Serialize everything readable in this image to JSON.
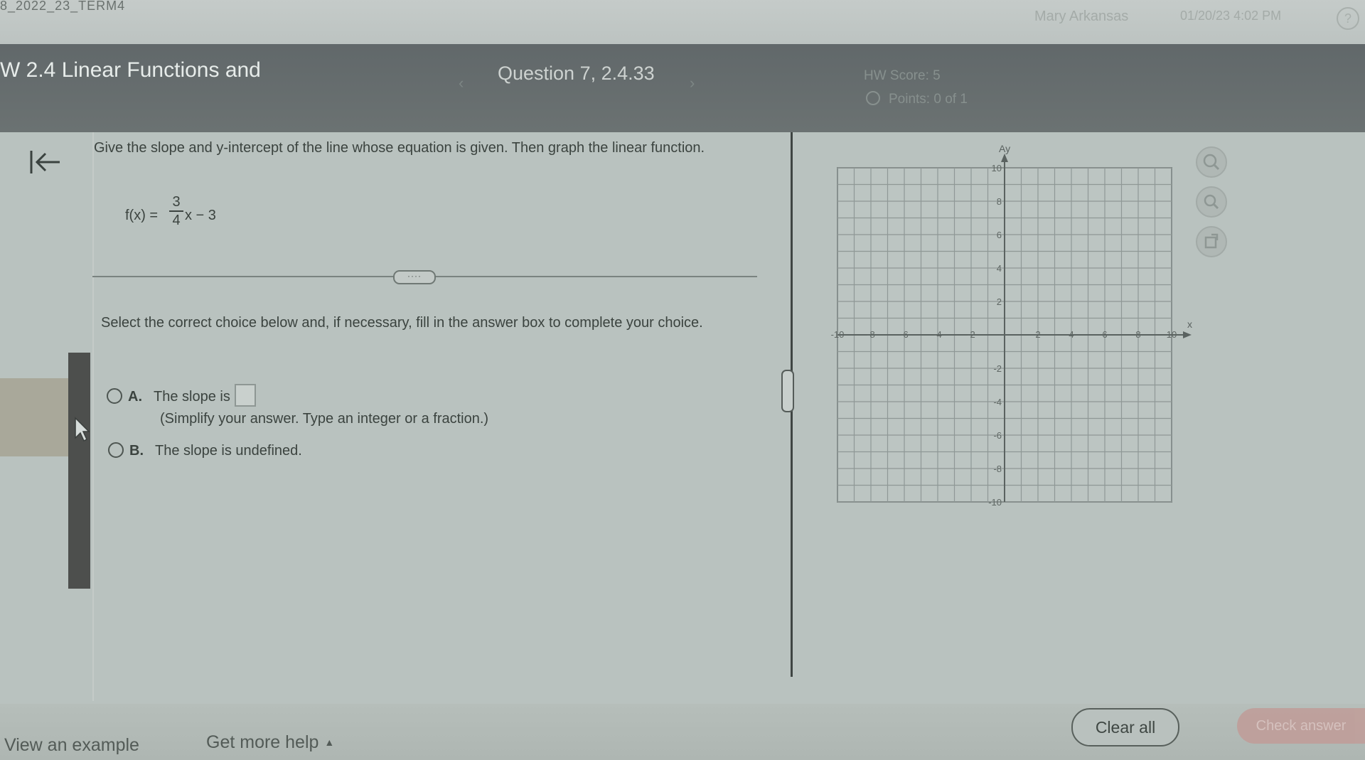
{
  "top": {
    "course": "8_2022_23_TERM4",
    "user": "Mary Arkansas",
    "datetime": "01/20/23 4:02 PM",
    "help_icon": "question-circle-icon"
  },
  "header": {
    "assignment_title": "W 2.4 Linear Functions and",
    "question_title": "Question 7, 2.4.33",
    "hw_score": "HW Score: 5",
    "points": "Points: 0 of 1"
  },
  "question": {
    "instructions": "Give the slope and y-intercept of the line whose equation is given. Then graph the linear function.",
    "equation": {
      "lhs": "f(x) =",
      "numerator": "3",
      "denominator": "4",
      "rhs": "x − 3"
    },
    "select_text": "Select the correct choice below and, if necessary, fill in the answer box to complete your choice.",
    "choice_a": {
      "letter": "A.",
      "text": "The slope is",
      "hint": "(Simplify your answer. Type an integer or a fraction.)"
    },
    "choice_b": {
      "letter": "B.",
      "text": "The slope is undefined."
    }
  },
  "graph": {
    "y_label": "Ay",
    "x_label": "x",
    "x_min": -10,
    "x_max": 10,
    "y_min": -10,
    "y_max": 10,
    "step": 1,
    "x_tick_labels": [
      "-10",
      "-8",
      "-6",
      "-4",
      "-2",
      "2",
      "4",
      "6",
      "8",
      "10"
    ],
    "y_tick_labels": [
      "10",
      "8",
      "6",
      "4",
      "2",
      "-2",
      "-4",
      "-6",
      "-8",
      "-10"
    ],
    "tools": [
      "zoom-in-icon",
      "zoom-out-icon",
      "share-icon"
    ]
  },
  "footer": {
    "view_example": "View an example",
    "more_help": "Get more help",
    "clear_all": "Clear all",
    "check_answer": "Check answer"
  }
}
